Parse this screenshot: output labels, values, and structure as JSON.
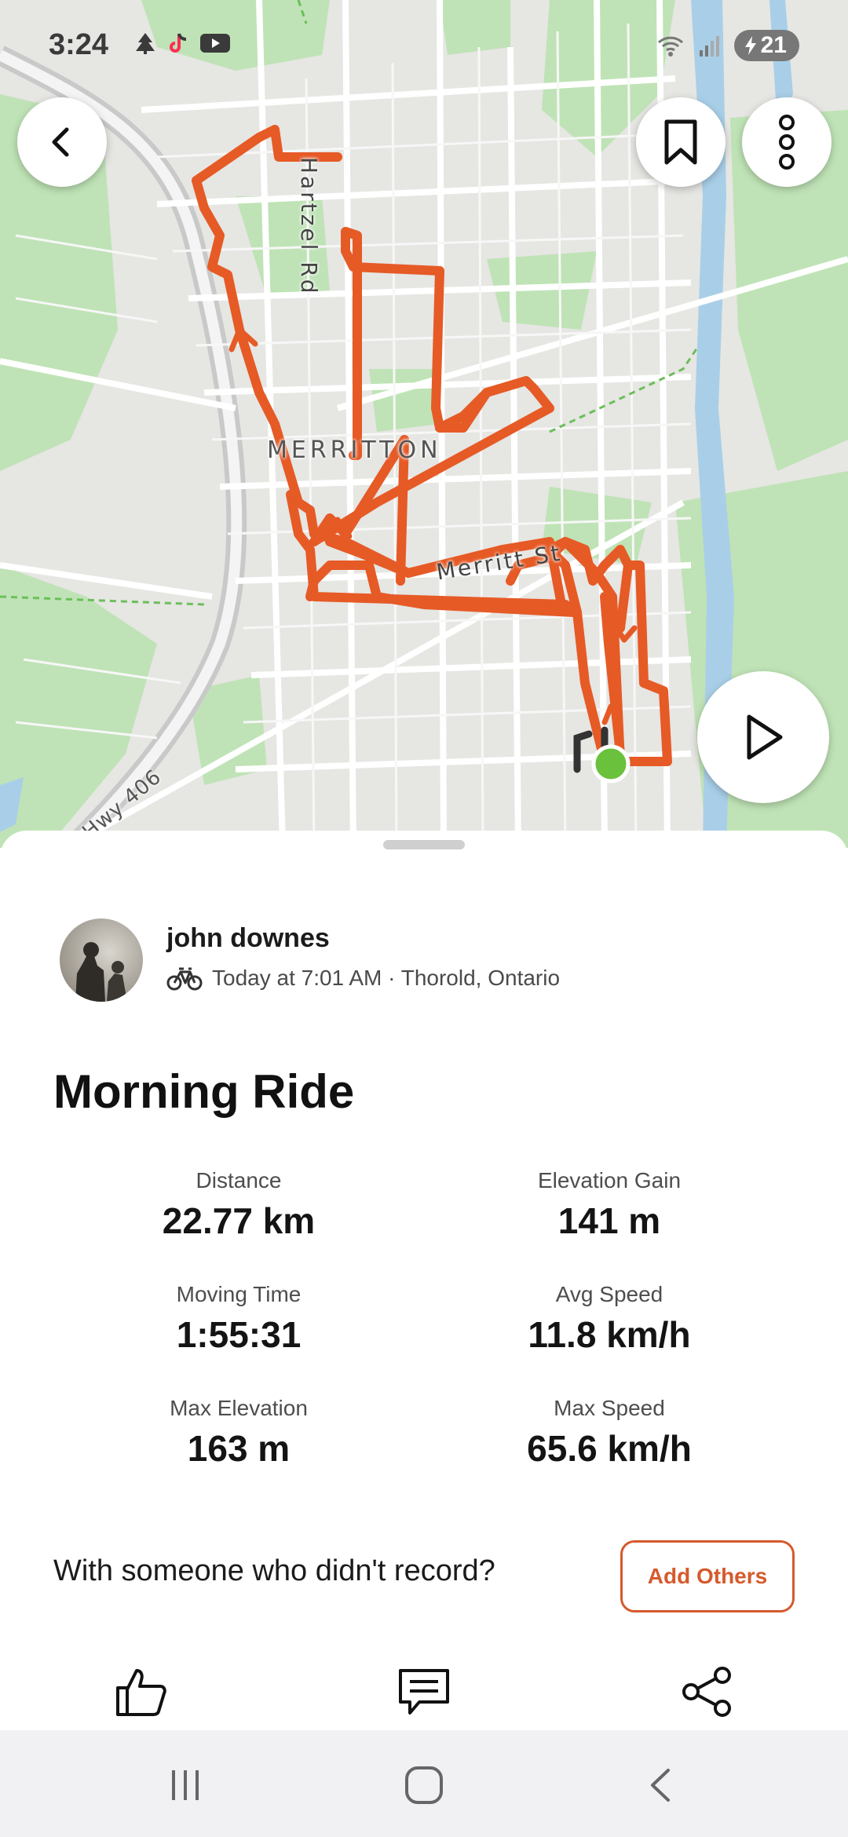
{
  "status_bar": {
    "time": "3:24",
    "icons": [
      "pine-icon",
      "tiktok-icon",
      "youtube-icon"
    ],
    "battery": "21"
  },
  "map": {
    "labels": {
      "neighborhood": "MERRITTON",
      "street_vertical": "Hartzel Rd",
      "street_horizontal": "Merritt St",
      "highway": "Hwy 406"
    },
    "route_color": "#e65a26",
    "start_marker_color": "#6ac13c"
  },
  "activity": {
    "athlete_name": "john downes",
    "meta": "Today at 7:01 AM · Thorold, Ontario",
    "title": "Morning Ride",
    "stats": [
      {
        "label": "Distance",
        "value": "22.77 km"
      },
      {
        "label": "Elevation Gain",
        "value": "141 m"
      },
      {
        "label": "Moving Time",
        "value": "1:55:31"
      },
      {
        "label": "Avg Speed",
        "value": "11.8 km/h"
      },
      {
        "label": "Max Elevation",
        "value": "163 m"
      },
      {
        "label": "Max Speed",
        "value": "65.6 km/h"
      }
    ],
    "prompt": "With someone who didn't record?",
    "add_others_label": "Add Others"
  },
  "colors": {
    "accent": "#d55a2c"
  }
}
